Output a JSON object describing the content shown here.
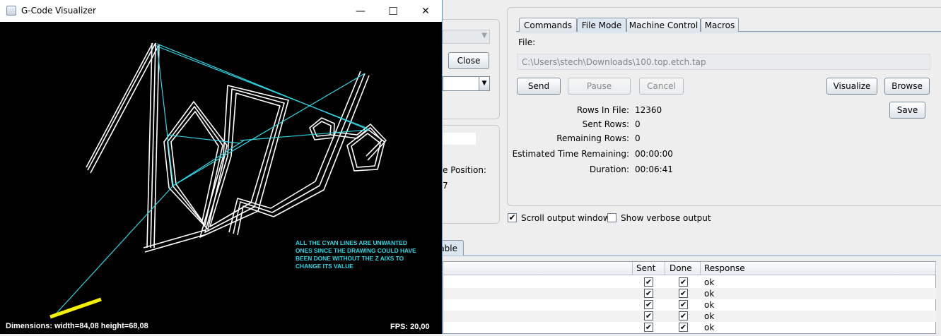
{
  "visualizer": {
    "title": "G-Code Visualizer",
    "controls": {
      "minimize": "—",
      "maximize": "☐",
      "close": "✕"
    },
    "note": "ALL THE CYAN LINES ARE UNWANTED ONES SINCE THE DRAWING COULD HAVE BEEN DONE WITHOUT THE Z AIXS TO CHANGE ITS VALUE",
    "dimensions": "Dimensions: width=84,08 height=68,08",
    "fps": "FPS: 20,00",
    "colors": {
      "path": "#ffffff",
      "rapid": "#2fd7e6",
      "tool": "#f4f000",
      "note": "#2fd7e6"
    }
  },
  "left_panel": {
    "close_button": "Close",
    "position_label_fragment": "e Position:",
    "position_value_fragment": "7"
  },
  "tabs": [
    {
      "label": "Commands",
      "active": false
    },
    {
      "label": "File Mode",
      "active": true
    },
    {
      "label": "Machine Control",
      "active": false
    },
    {
      "label": "Macros",
      "active": false
    }
  ],
  "file_mode": {
    "file_label": "File:",
    "file_path": "C:\\Users\\stech\\Downloads\\100.top.etch.tap",
    "buttons": {
      "send": "Send",
      "pause": "Pause",
      "cancel": "Cancel",
      "visualize": "Visualize",
      "browse": "Browse",
      "save": "Save"
    },
    "stats": [
      {
        "label": "Rows In File:",
        "value": "12360"
      },
      {
        "label": "Sent Rows:",
        "value": "0"
      },
      {
        "label": "Remaining Rows:",
        "value": "0"
      },
      {
        "label": "Estimated Time Remaining:",
        "value": "00:00:00"
      },
      {
        "label": "Duration:",
        "value": "00:06:41"
      }
    ]
  },
  "options": {
    "scroll_output": {
      "label": "Scroll output window",
      "checked": true
    },
    "verbose_output": {
      "label": "Show verbose output",
      "checked": false
    }
  },
  "bottom_tab_fragment": "able",
  "table": {
    "headers": [
      "Sent",
      "Done",
      "Response"
    ],
    "rows": [
      {
        "sent": true,
        "done": true,
        "response": "ok"
      },
      {
        "sent": true,
        "done": true,
        "response": "ok"
      },
      {
        "sent": true,
        "done": true,
        "response": "ok"
      },
      {
        "sent": true,
        "done": true,
        "response": "ok"
      },
      {
        "sent": true,
        "done": true,
        "response": "ok"
      }
    ]
  }
}
